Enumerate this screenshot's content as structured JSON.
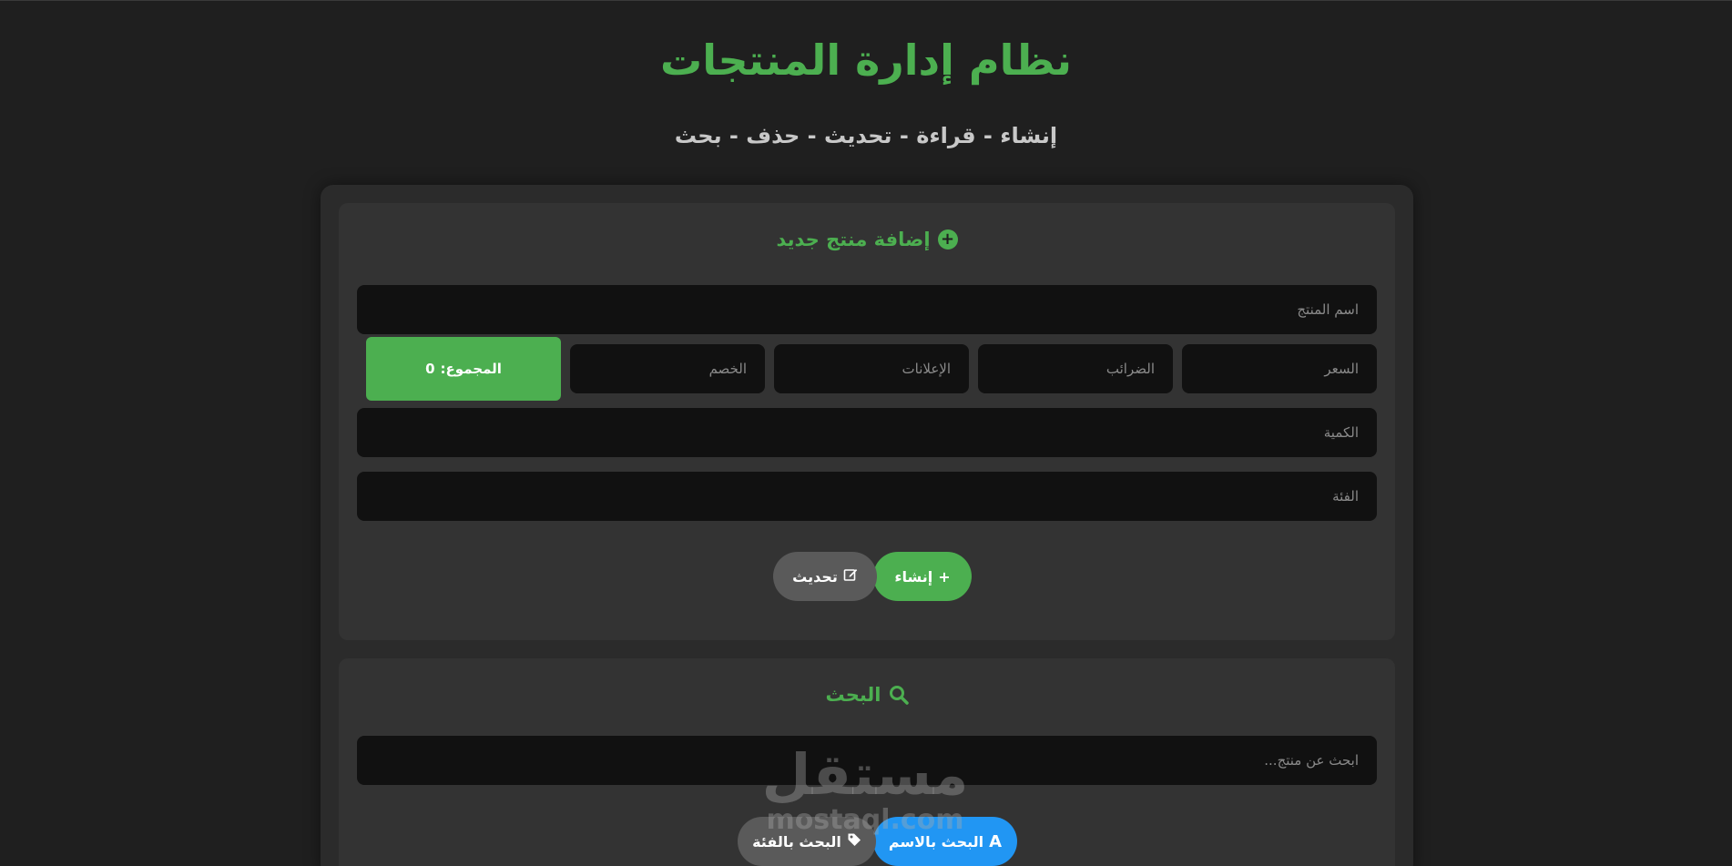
{
  "header": {
    "title": "نظام إدارة المنتجات",
    "subtitle": "إنشاء - قراءة - تحديث - حذف - بحث"
  },
  "create_card": {
    "title": "إضافة منتج جديد",
    "title_icon": "plus-circle-icon",
    "fields": {
      "name_placeholder": "اسم المنتج",
      "price_placeholder": "السعر",
      "taxes_placeholder": "الضرائب",
      "ads_placeholder": "الإعلانات",
      "discount_placeholder": "الخصم",
      "count_placeholder": "الكمية",
      "category_placeholder": "الفئة"
    },
    "total_label": "المجموع:",
    "total_value": "0",
    "create_button": "إنشاء",
    "update_button": "تحديث"
  },
  "search_card": {
    "title": "البحث",
    "title_icon": "search-icon",
    "search_placeholder": "ابحث عن منتج...",
    "search_by_name_button": "البحث بالاسم",
    "search_by_category_button": "البحث بالفئة"
  },
  "watermark": {
    "brand": "مستقل",
    "domain": "mostaql.com"
  },
  "colors": {
    "accent_green": "#4caf50",
    "accent_blue": "#2196f3",
    "background": "#1f1f1f",
    "card": "#333333",
    "input": "#111111",
    "secondary_button": "#5a5a5a"
  }
}
